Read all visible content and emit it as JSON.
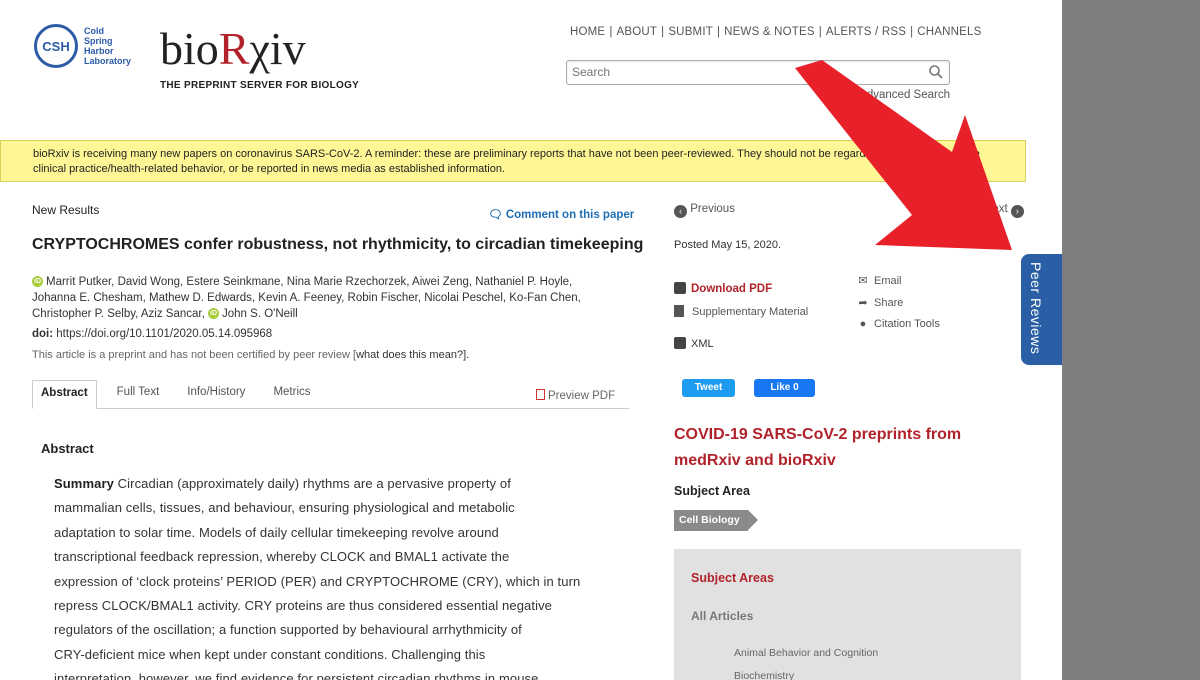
{
  "header": {
    "csh_logo_text": "Cold Spring Harbor Laboratory",
    "csh_initials": "CSH",
    "site_name_part1": "bio",
    "site_name_part2": "R",
    "site_name_part3": "χiv",
    "tagline": "THE PREPRINT SERVER FOR BIOLOGY",
    "nav": [
      "HOME",
      "ABOUT",
      "SUBMIT",
      "NEWS & NOTES",
      "ALERTS / RSS",
      "CHANNELS"
    ],
    "search_placeholder": "Search",
    "advanced_search": "Advanced Search"
  },
  "banner": {
    "text": "bioRxiv is receiving many new papers on coronavirus SARS-CoV-2.  A reminder: these are preliminary reports that have not been peer-reviewed. They should not be regarded as conclusive, guide clinical practice/health-related behavior, or be reported in news media as established information."
  },
  "article": {
    "section_label": "New Results",
    "comment_link": "Comment on this paper",
    "title": "CRYPTOCHROMES confer robustness, not rhythmicity, to circadian timekeeping",
    "authors_line1": "Marrit Putker, David Wong, Estere Seinkmane, Nina Marie Rzechorzek, Aiwei Zeng, Nathaniel P. Hoyle,",
    "authors_line2": "Johanna E. Chesham, Mathew D. Edwards, Kevin A. Feeney, Robin Fischer, Nicolai Peschel, Ko-Fan Chen,",
    "authors_line3a": "Christopher P. Selby, Aziz Sancar,",
    "authors_line3b": "John S. O'Neill",
    "doi_label": "doi:",
    "doi_value": "https://doi.org/10.1101/2020.05.14.095968",
    "preprint_note": "This article is a preprint and has not been certified by peer review [",
    "preprint_link": "what does this mean?",
    "preprint_note_end": "].",
    "tabs": [
      "Abstract",
      "Full Text",
      "Info/History",
      "Metrics"
    ],
    "preview_pdf": "Preview PDF",
    "abstract_heading": "Abstract",
    "abstract_lead": "Summary",
    "abstract_lines": [
      " Circadian (approximately daily) rhythms are a pervasive property of",
      "mammalian cells, tissues, and behaviour, ensuring physiological and metabolic",
      "adaptation to solar time. Models of daily cellular timekeeping revolve around",
      "transcriptional feedback repression, whereby CLOCK and BMAL1 activate the",
      "expression of ‘clock proteins’ PERIOD (PER) and CRYPTOCHROME (CRY), which in turn",
      "repress CLOCK/BMAL1 activity. CRY proteins are thus considered essential negative",
      "regulators of the oscillation; a function supported by behavioural arrhythmicity of",
      "CRY-deficient mice when kept under constant conditions. Challenging this",
      "interpretation, however, we find evidence for persistent circadian rhythms in mouse"
    ]
  },
  "sidebar": {
    "previous": "Previous",
    "next": "Next",
    "posted": "Posted May 15, 2020.",
    "download_pdf": "Download PDF",
    "supplementary": "Supplementary Material",
    "xml": "XML",
    "email": "Email",
    "share": "Share",
    "citation_tools": "Citation Tools",
    "tweet": "Tweet",
    "like": "Like 0",
    "covid_heading": "COVID-19 SARS-CoV-2 preprints from medRxiv and bioRxiv",
    "subject_area_heading": "Subject Area",
    "subject_tag": "Cell Biology",
    "subject_areas_box_heading": "Subject Areas",
    "all_articles": "All Articles",
    "subject_list": [
      "Animal Behavior and Cognition",
      "Biochemistry"
    ]
  },
  "peer_reviews_tab": "Peer Reviews",
  "colors": {
    "brand_red": "#b2222a",
    "link_blue": "#1f6eb3",
    "banner_yellow": "#fff796",
    "peer_tab_blue": "#2a5fa5",
    "arrow_red": "#e8202a"
  }
}
